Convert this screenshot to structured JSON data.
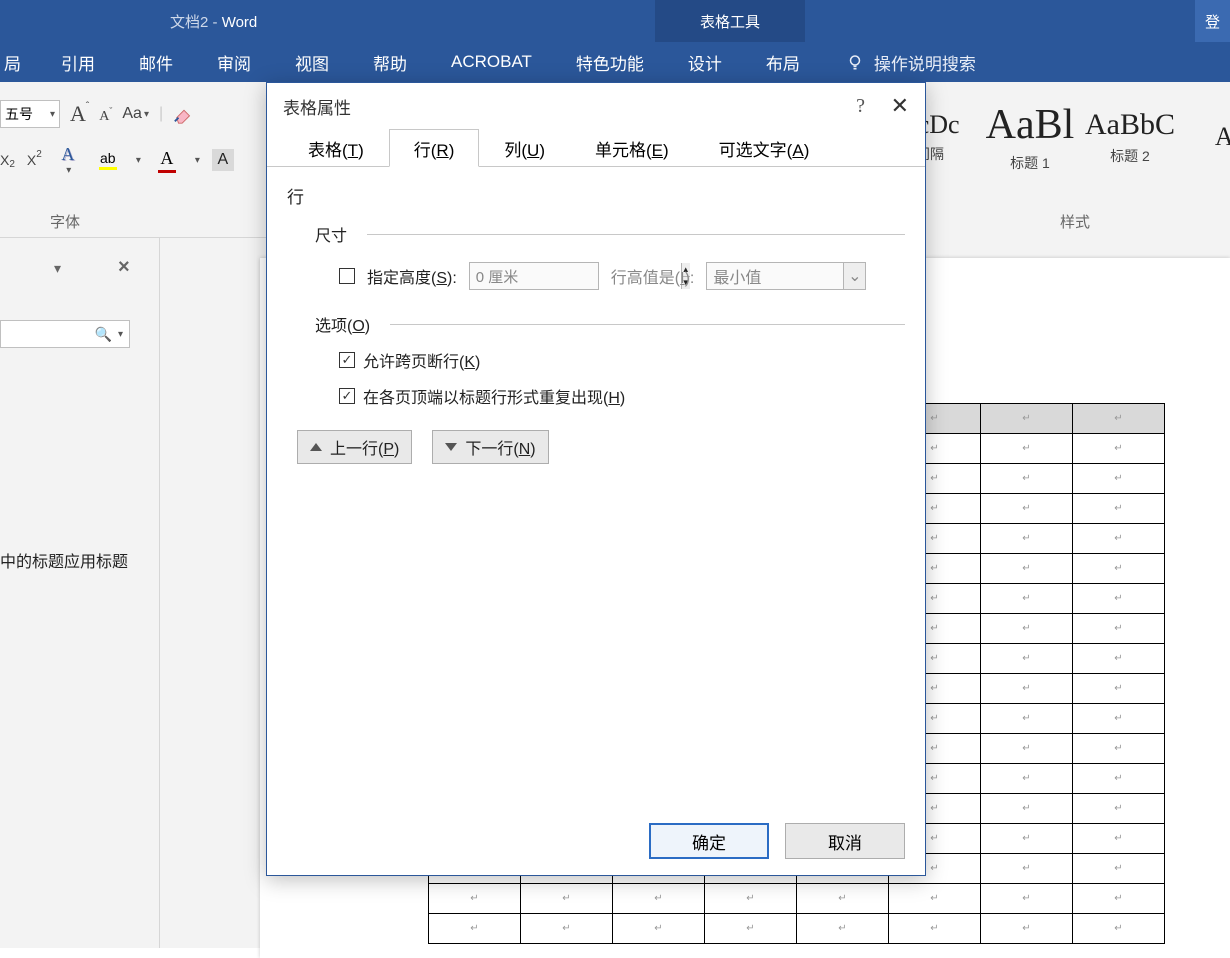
{
  "title_bar": {
    "doc": "文档2",
    "sep": "  -  ",
    "app": "Word",
    "table_tools": "表格工具",
    "login": "登"
  },
  "ribbon": {
    "tabs": [
      "局",
      "引用",
      "邮件",
      "审阅",
      "视图",
      "帮助",
      "ACROBAT",
      "特色功能",
      "设计",
      "布局"
    ],
    "tell_me": "操作说明搜索",
    "font_group": "字体",
    "font_size": "五号",
    "styles_group": "样式",
    "style_previews": [
      "CcDc",
      "AaBl",
      "AaBbC",
      "Aa"
    ],
    "style_names": [
      "间隔",
      "标题 1",
      "标题 2",
      ""
    ]
  },
  "nav": {
    "text": "中的标题应用标题"
  },
  "dialog": {
    "title": "表格属性",
    "tabs": {
      "table": "表格(T)",
      "row": "行(R)",
      "column": "列(U)",
      "cell": "单元格(E)",
      "alt": "可选文字(A)"
    },
    "body": {
      "heading": "行",
      "size_label": "尺寸",
      "specify_height": "指定高度(S):",
      "height_value": "0 厘米",
      "row_height_is": "行高值是(I):",
      "row_height_mode": "最小值",
      "options_label": "选项(O)",
      "allow_break": "允许跨页断行(K)",
      "repeat_header": "在各页顶端以标题行形式重复出现(H)",
      "prev_row": "上一行(P)",
      "next_row": "下一行(N)"
    },
    "buttons": {
      "ok": "确定",
      "cancel": "取消"
    }
  }
}
